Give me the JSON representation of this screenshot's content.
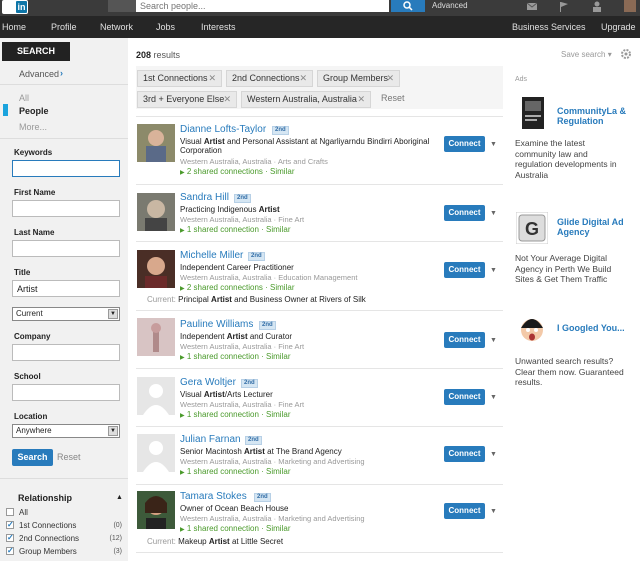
{
  "topbar": {
    "logo_letters": "in",
    "search_placeholder": "Search people...",
    "advanced": "Advanced"
  },
  "nav": [
    "Home",
    "Profile",
    "Network",
    "Jobs",
    "Interests",
    "Business Services",
    "Upgrade"
  ],
  "sidebar": {
    "search_tab": "SEARCH",
    "advanced": "Advanced",
    "advanced_chevron": "›",
    "filter_all": "All",
    "filter_people": "People",
    "filter_more": "More...",
    "keywords_label": "Keywords",
    "keywords_value": "",
    "first_name_label": "First Name",
    "last_name_label": "Last Name",
    "title_label": "Title",
    "title_value": "Artist",
    "title_scope": "Current",
    "company_label": "Company",
    "school_label": "School",
    "location_label": "Location",
    "location_value": "Anywhere",
    "search_button": "Search",
    "reset_link": "Reset",
    "relationship_title": "Relationship",
    "relationship": [
      {
        "label": "All",
        "count": "",
        "checked": false
      },
      {
        "label": "1st Connections",
        "count": "(0)",
        "checked": true
      },
      {
        "label": "2nd Connections",
        "count": "(12)",
        "checked": true
      },
      {
        "label": "Group Members",
        "count": "(3)",
        "checked": true
      }
    ]
  },
  "results": {
    "count": "208",
    "count_suffix": "results",
    "save_search": "Save search",
    "save_search_dd": "▾",
    "chips": [
      "1st Connections",
      "2nd Connections",
      "Group Members",
      "3rd + Everyone Else",
      "Western Australia, Australia"
    ],
    "reset": "Reset",
    "connect_label": "Connect",
    "current_label": "Current:",
    "people": [
      {
        "name": "Dianne Lofts-Taylor",
        "degree": "2nd",
        "headline_pre": "Visual ",
        "headline_bold": "Artist",
        "headline_post": " and Personal Assistant at Ngarliyarndu Bindirri Aboriginal Corporation",
        "location": "Western Australia, Australia  ·  Arts and Crafts",
        "shared": "2 shared connections",
        "similar": "Similar",
        "current_pre": "",
        "current_bold": "",
        "current_post": ""
      },
      {
        "name": "Sandra Hill",
        "degree": "2nd",
        "headline_pre": "Practicing Indigenous ",
        "headline_bold": "Artist",
        "headline_post": "",
        "location": "Western Australia, Australia  ·  Fine Art",
        "shared": "1 shared connection",
        "similar": "Similar",
        "current_pre": "",
        "current_bold": "",
        "current_post": ""
      },
      {
        "name": "Michelle Miller",
        "degree": "2nd",
        "headline_pre": "Independent Career Practitioner",
        "headline_bold": "",
        "headline_post": "",
        "location": "Western Australia, Australia  ·  Education Management",
        "shared": "2 shared connections",
        "similar": "Similar",
        "current_pre": "Principal ",
        "current_bold": "Artist",
        "current_post": " and Business Owner at Rivers of Silk"
      },
      {
        "name": "Pauline Williams",
        "degree": "2nd",
        "headline_pre": "Independent ",
        "headline_bold": "Artist",
        "headline_post": " and Curator",
        "location": "Western Australia, Australia  ·  Fine Art",
        "shared": "1 shared connection",
        "similar": "Similar",
        "current_pre": "",
        "current_bold": "",
        "current_post": ""
      },
      {
        "name": "Gera Woltjer",
        "degree": "2nd",
        "headline_pre": "Visual ",
        "headline_bold": "Artist",
        "headline_post": "/Arts Lecturer",
        "location": "Western Australia, Australia  ·  Fine Art",
        "shared": "1 shared connection",
        "similar": "Similar",
        "current_pre": "",
        "current_bold": "",
        "current_post": ""
      },
      {
        "name": "Julian Farnan",
        "degree": "2nd",
        "headline_pre": "Senior Macintosh ",
        "headline_bold": "Artist",
        "headline_post": " at The Brand Agency",
        "location": "Western Australia, Australia  ·  Marketing and Advertising",
        "shared": "1 shared connection",
        "similar": "Similar",
        "current_pre": "",
        "current_bold": "",
        "current_post": ""
      },
      {
        "name": "Tamara Stokes",
        "degree": "2nd",
        "headline_pre": "Owner of Ocean Beach House",
        "headline_bold": "",
        "headline_post": "",
        "location": "Western Australia, Australia  ·  Marketing and Advertising",
        "shared": "1 shared connection",
        "similar": "Similar",
        "current_pre": "Makeup ",
        "current_bold": "Artist",
        "current_post": " at Little Secret"
      }
    ]
  },
  "ads": {
    "label": "Ads",
    "items": [
      {
        "title": "CommunityLa & Regulation",
        "body": "Examine the latest community law and regulation developments in Australia"
      },
      {
        "title": "Glide Digital Ad Agency",
        "body": "Not Your Average Digital Agency in Perth We Build Sites & Get Them Traffic"
      },
      {
        "title": "I Googled You...",
        "body": "Unwanted search results? Clear them now. Guaranteed results."
      }
    ]
  },
  "colors": {
    "brand": "#287bbc",
    "green": "#4a9a2b",
    "navbar": "#262626"
  }
}
